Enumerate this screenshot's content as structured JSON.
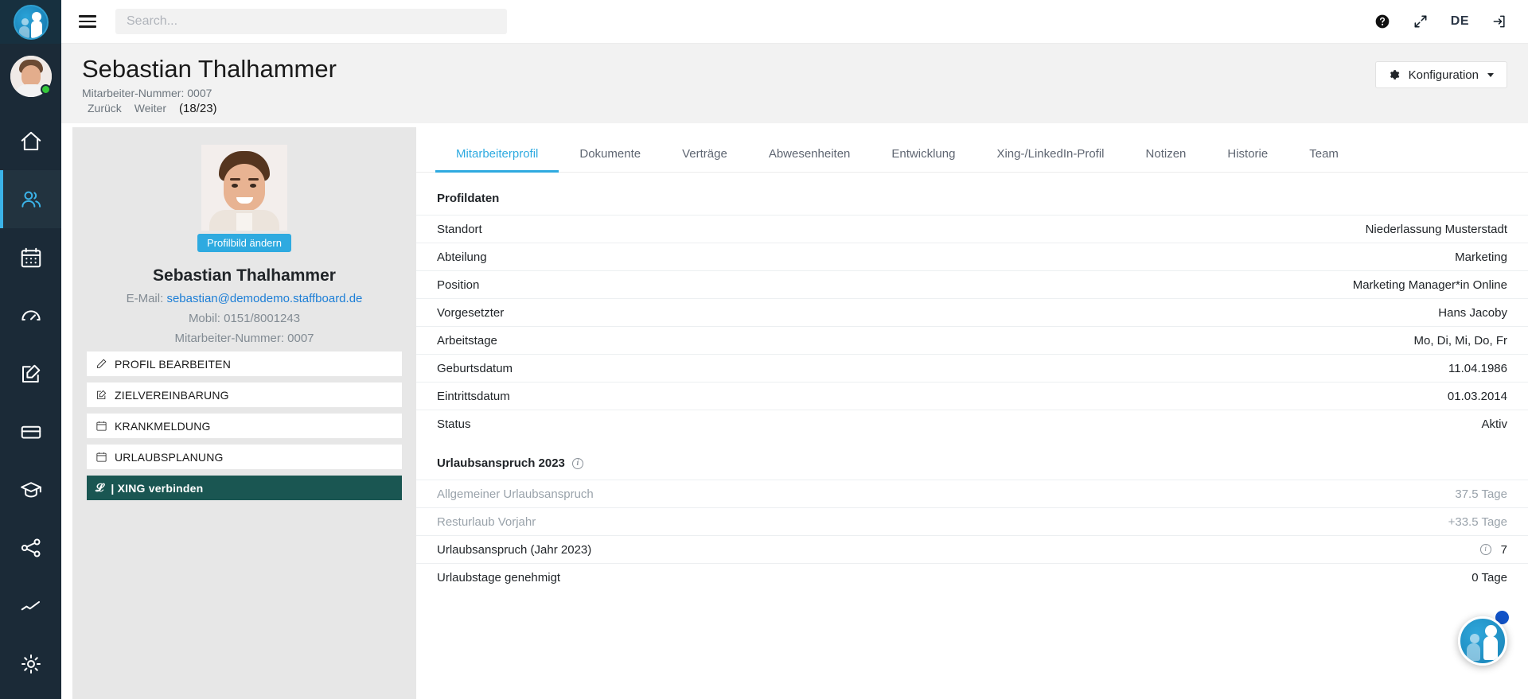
{
  "topbar": {
    "menu_icon": "hamburger-icon",
    "search": {
      "value": "",
      "placeholder": "Search..."
    },
    "help_icon": "help-circle-icon",
    "fullscreen_icon": "expand-arrows-icon",
    "language": "DE",
    "logout_icon": "logout-icon"
  },
  "rail": {
    "logo_icon": "staffboard-logo-icon",
    "avatar_icon": "user-avatar",
    "items": [
      {
        "icon": "home-icon",
        "name": "home",
        "active": false
      },
      {
        "icon": "users-icon",
        "name": "employees",
        "active": true
      },
      {
        "icon": "calendar-icon",
        "name": "calendar",
        "active": false
      },
      {
        "icon": "gauge-icon",
        "name": "dashboard",
        "active": false
      },
      {
        "icon": "edit-square-icon",
        "name": "notes",
        "active": false
      },
      {
        "icon": "card-icon",
        "name": "payroll",
        "active": false
      },
      {
        "icon": "graduation-cap-icon",
        "name": "training",
        "active": false
      },
      {
        "icon": "share-nodes-icon",
        "name": "organisation",
        "active": false
      },
      {
        "icon": "trend-line-icon",
        "name": "reports",
        "active": false
      },
      {
        "icon": "gear-icon",
        "name": "settings",
        "active": false
      }
    ]
  },
  "header": {
    "title": "Sebastian Thalhammer",
    "employee_number": "Mitarbeiter-Nummer: 0007",
    "prev_label": "Zurück",
    "next_label": "Weiter",
    "counter": "(18/23)",
    "config_label": "Konfiguration",
    "config_icon": "gear-icon"
  },
  "profile_card": {
    "photo_alt": "profile-photo",
    "change_photo_label": "Profilbild ändern",
    "name": "Sebastian Thalhammer",
    "email_label": "E-Mail:",
    "email": "sebastian@demodemo.staffboard.de",
    "mobile": "Mobil: 0151/8001243",
    "employee_number": "Mitarbeiter-Nummer: 0007",
    "actions": [
      {
        "label": "PROFIL BEARBEITEN",
        "icon": "pencil-icon",
        "style": "default"
      },
      {
        "label": "ZIELVEREINBARUNG",
        "icon": "edit-square-icon",
        "style": "default"
      },
      {
        "label": "KRANKMELDUNG",
        "icon": "calendar-icon",
        "style": "default"
      },
      {
        "label": "URLAUBSPLANUNG",
        "icon": "calendar-icon",
        "style": "default"
      },
      {
        "label": "| XING verbinden",
        "icon": "xing-icon",
        "style": "xing"
      }
    ]
  },
  "tabs": [
    {
      "label": "Mitarbeiterprofil",
      "active": true
    },
    {
      "label": "Dokumente",
      "active": false
    },
    {
      "label": "Verträge",
      "active": false
    },
    {
      "label": "Abwesenheiten",
      "active": false
    },
    {
      "label": "Entwicklung",
      "active": false
    },
    {
      "label": "Xing-/LinkedIn-Profil",
      "active": false
    },
    {
      "label": "Notizen",
      "active": false
    },
    {
      "label": "Historie",
      "active": false
    },
    {
      "label": "Team",
      "active": false
    }
  ],
  "profildaten": {
    "title": "Profildaten",
    "rows": [
      {
        "label": "Standort",
        "value": "Niederlassung Musterstadt"
      },
      {
        "label": "Abteilung",
        "value": "Marketing"
      },
      {
        "label": "Position",
        "value": "Marketing Manager*in Online"
      },
      {
        "label": "Vorgesetzter",
        "value": "Hans Jacoby"
      },
      {
        "label": "Arbeitstage",
        "value": "Mo, Di, Mi, Do, Fr"
      },
      {
        "label": "Geburtsdatum",
        "value": "11.04.1986"
      },
      {
        "label": "Eintrittsdatum",
        "value": "01.03.2014"
      },
      {
        "label": "Status",
        "value": "Aktiv"
      }
    ]
  },
  "urlaubsanspruch": {
    "title": "Urlaubsanspruch 2023",
    "title_info_icon": "info-icon",
    "rows": [
      {
        "label": "Allgemeiner Urlaubsanspruch",
        "value": "37.5 Tage",
        "muted": true,
        "info": false
      },
      {
        "label": "Resturlaub Vorjahr",
        "value": "+33.5 Tage",
        "muted": true,
        "info": false
      },
      {
        "label": "Urlaubsanspruch (Jahr 2023)",
        "value": "7",
        "muted": false,
        "info": true
      },
      {
        "label": "Urlaubstage genehmigt",
        "value": "0 Tage",
        "muted": false,
        "info": false
      }
    ]
  },
  "chat_widget": {
    "icon": "staffboard-chat-icon",
    "badge": "notification-badge"
  },
  "colors": {
    "accent": "#2eaae0",
    "rail_bg": "#1b2a37",
    "xing_bg": "#1a5652",
    "link": "#1c7ed6",
    "muted_text": "#9aa3ab",
    "page_bg": "#f2f2f2"
  }
}
